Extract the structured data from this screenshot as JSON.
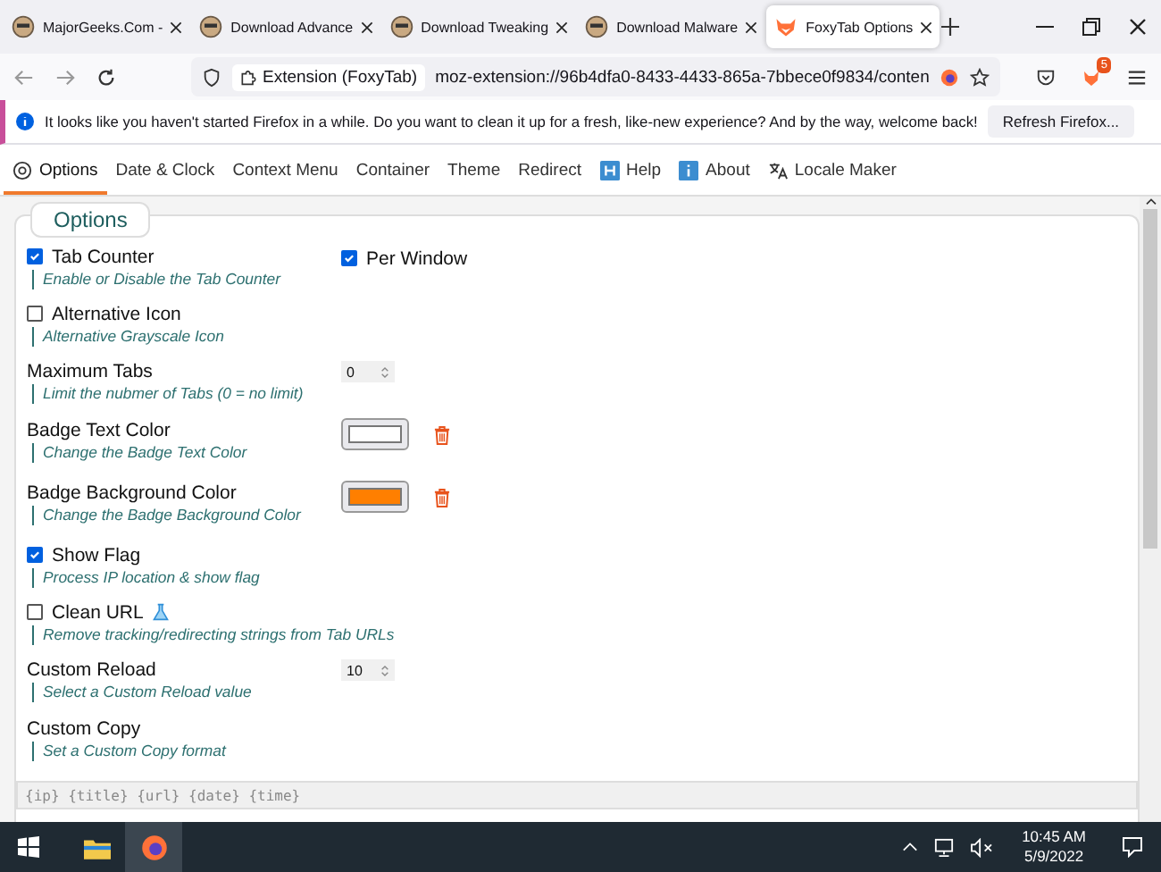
{
  "browser_tabs": [
    {
      "title": "MajorGeeks.Com -",
      "selected": false
    },
    {
      "title": "Download Advance",
      "selected": false
    },
    {
      "title": "Download Tweaking",
      "selected": false
    },
    {
      "title": "Download Malware",
      "selected": false
    },
    {
      "title": "FoxyTab Options",
      "selected": true
    }
  ],
  "toolbar": {
    "identity": "Extension (FoxyTab)",
    "url": "moz-extension://96b4dfa0-8433-4433-865a-7bbece0f9834/conten",
    "extension_badge": "5"
  },
  "notification": {
    "message": "It looks like you haven't started Firefox in a while. Do you want to clean it up for a fresh, like-new experience? And by the way, welcome back!",
    "button": "Refresh Firefox..."
  },
  "nav_tabs": [
    {
      "label": "Options",
      "kind": "settings",
      "selected": true
    },
    {
      "label": "Date & Clock",
      "kind": "plain",
      "selected": false
    },
    {
      "label": "Context Menu",
      "kind": "plain",
      "selected": false
    },
    {
      "label": "Container",
      "kind": "plain",
      "selected": false
    },
    {
      "label": "Theme",
      "kind": "plain",
      "selected": false
    },
    {
      "label": "Redirect",
      "kind": "plain",
      "selected": false
    },
    {
      "label": "Help",
      "kind": "help",
      "selected": false
    },
    {
      "label": "About",
      "kind": "about",
      "selected": false
    },
    {
      "label": "Locale Maker",
      "kind": "locale",
      "selected": false
    }
  ],
  "section": {
    "title": "Options"
  },
  "settings": [
    {
      "kind": "checkbox",
      "label": "Tab Counter",
      "hint": "Enable or Disable the Tab Counter",
      "checked": true,
      "side": {
        "label": "Per Window",
        "checked": true
      }
    },
    {
      "kind": "checkbox",
      "label": "Alternative Icon",
      "hint": "Alternative Grayscale Icon",
      "checked": false
    },
    {
      "kind": "number",
      "label": "Maximum Tabs",
      "hint": "Limit the nubmer of Tabs (0 = no limit)",
      "value": "0"
    },
    {
      "kind": "color",
      "label": "Badge Text Color",
      "hint": "Change the Badge Text Color",
      "color": "#ffffff"
    },
    {
      "kind": "color",
      "label": "Badge Background Color",
      "hint": "Change the Badge Background Color",
      "color": "#ff7f00"
    },
    {
      "kind": "checkbox",
      "label": "Show Flag",
      "hint": "Process IP location & show flag",
      "checked": true
    },
    {
      "kind": "checkbox",
      "label": "Clean URL",
      "hint": "Remove tracking/redirecting strings from Tab URLs",
      "checked": false,
      "experimental": true
    },
    {
      "kind": "number",
      "label": "Custom Reload",
      "hint": "Select a Custom Reload value",
      "value": "10"
    },
    {
      "kind": "text",
      "label": "Custom Copy",
      "hint": "Set a Custom Copy format",
      "placeholder": "{ip} {title} {url} {date} {time}"
    }
  ],
  "taskbar": {
    "time": "10:45 AM",
    "date": "5/9/2022"
  }
}
